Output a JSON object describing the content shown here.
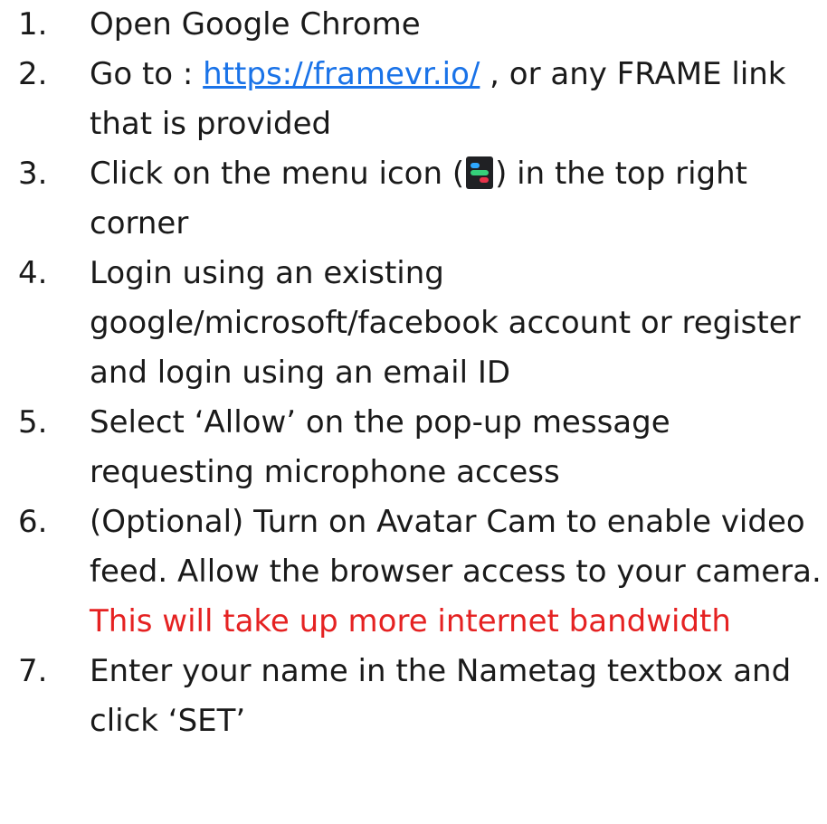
{
  "steps": [
    {
      "number": "1.",
      "text": "Open Google Chrome"
    },
    {
      "number": "2.",
      "before": "Go to : ",
      "link": "https://framevr.io/",
      "after": " , or any FRAME link that is provided"
    },
    {
      "number": "3.",
      "before": "Click on the menu icon (",
      "icon": "frame-menu-icon",
      "after": ") in the top right corner"
    },
    {
      "number": "4.",
      "text": "Login using an existing google/microsoft/facebook account or register and login using an email ID"
    },
    {
      "number": "5.",
      "text": "Select ‘Allow’ on the pop-up message requesting microphone access"
    },
    {
      "number": "6.",
      "text": "(Optional) Turn on Avatar Cam to enable video feed. Allow the browser access to your camera. ",
      "warning": "This will take up more internet bandwidth"
    },
    {
      "number": "7.",
      "text": "Enter your name in the Nametag textbox and click ‘SET’"
    }
  ],
  "colors": {
    "text": "#1a1a1a",
    "link": "#1a73e8",
    "warning": "#e52222",
    "icon_bg": "#202124"
  }
}
